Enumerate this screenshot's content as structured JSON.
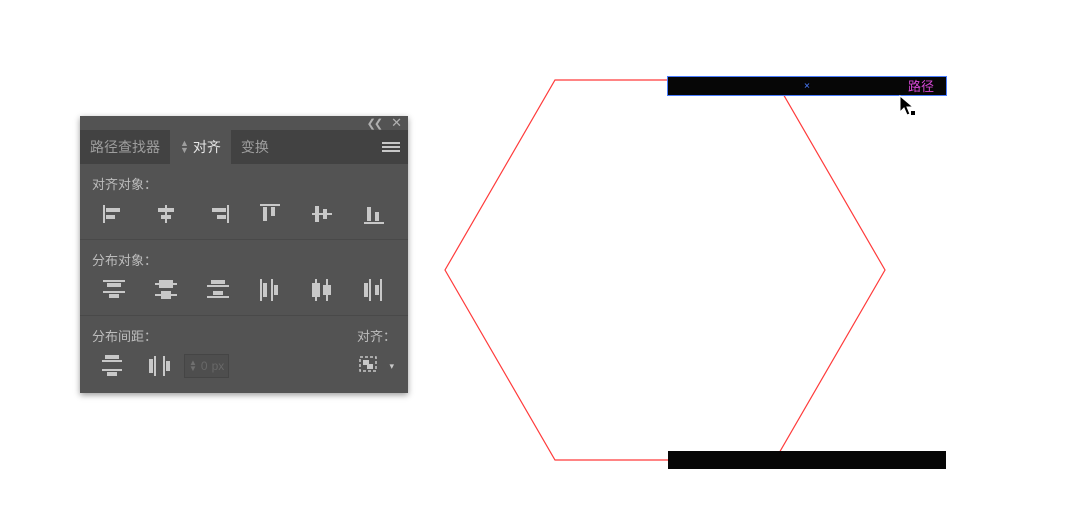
{
  "panel": {
    "tabs": {
      "pathfinder": "路径查找器",
      "align": "对齐",
      "transform": "变换"
    },
    "sections": {
      "align_objects": "对齐对象：",
      "distribute_objects": "分布对象：",
      "distribute_spacing": "分布间距：",
      "align_to": "对齐："
    },
    "spacing_field": {
      "value": "0",
      "unit": "px"
    }
  },
  "canvas": {
    "tooltip": "路径"
  }
}
